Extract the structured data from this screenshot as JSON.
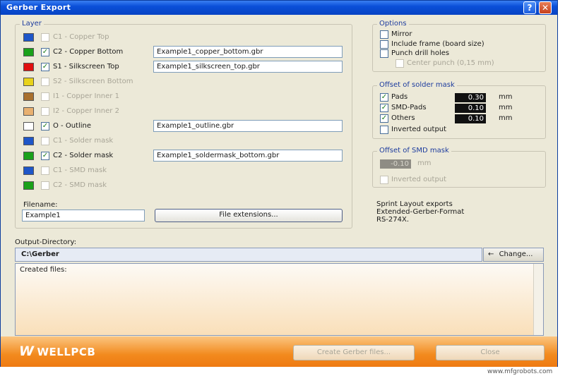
{
  "window": {
    "title": "Gerber Export"
  },
  "titlebar": {
    "help_glyph": "?",
    "close_glyph": "✕"
  },
  "layer_group": {
    "legend": "Layer",
    "layers": [
      {
        "label": "C1 - Copper Top",
        "color": "#1e56c8",
        "checked": false,
        "enabled": false,
        "filename": ""
      },
      {
        "label": "C2 - Copper Bottom",
        "color": "#1aa11a",
        "checked": true,
        "enabled": true,
        "filename": "Example1_copper_bottom.gbr"
      },
      {
        "label": "S1 - Silkscreen Top",
        "color": "#e01010",
        "checked": true,
        "enabled": true,
        "filename": "Example1_silkscreen_top.gbr"
      },
      {
        "label": "S2 - Silkscreen Bottom",
        "color": "#e8d21a",
        "checked": false,
        "enabled": false,
        "filename": ""
      },
      {
        "label": "I1 - Copper Inner 1",
        "color": "#a8702e",
        "checked": false,
        "enabled": false,
        "filename": ""
      },
      {
        "label": "I2 - Copper Inner 2",
        "color": "#e8b070",
        "checked": false,
        "enabled": false,
        "filename": ""
      },
      {
        "label": "O - Outline",
        "color": "#ffffff",
        "checked": true,
        "enabled": true,
        "filename": "Example1_outline.gbr"
      },
      {
        "label": "C1 - Solder mask",
        "color": "#1e56c8",
        "checked": false,
        "enabled": false,
        "filename": ""
      },
      {
        "label": "C2 - Solder mask",
        "color": "#1aa11a",
        "checked": true,
        "enabled": true,
        "filename": "Example1_soldermask_bottom.gbr"
      },
      {
        "label": "C1 - SMD mask",
        "color": "#1e56c8",
        "checked": false,
        "enabled": false,
        "filename": ""
      },
      {
        "label": "C2 - SMD mask",
        "color": "#1aa11a",
        "checked": false,
        "enabled": false,
        "filename": ""
      }
    ],
    "filename_label": "Filename:",
    "filename_value": "Example1",
    "file_ext_button": "File extensions..."
  },
  "options": {
    "legend": "Options",
    "mirror": "Mirror",
    "include_frame": "Include frame (board size)",
    "punch_drill": "Punch drill holes",
    "center_punch": "Center punch (0,15 mm)"
  },
  "solder_offset": {
    "legend": "Offset of solder mask",
    "rows": [
      {
        "label": "Pads",
        "value": "0.30",
        "unit": "mm"
      },
      {
        "label": "SMD-Pads",
        "value": "0.10",
        "unit": "mm"
      },
      {
        "label": "Others",
        "value": "0.10",
        "unit": "mm"
      }
    ],
    "inverted": "Inverted output"
  },
  "smd_offset": {
    "legend": "Offset of SMD mask",
    "value": "-0.10",
    "unit": "mm",
    "inverted": "Inverted output"
  },
  "info_text": [
    "Sprint Layout exports",
    "Extended-Gerber-Format",
    "RS-274X."
  ],
  "output": {
    "label": "Output-Directory:",
    "path": "C:\\Gerber",
    "change_button": "Change...",
    "change_arrow": "←",
    "created_label": "Created files:"
  },
  "footer": {
    "logo": "WELLPCB",
    "create_button": "Create Gerber files...",
    "close_button": "Close"
  },
  "watermark": "www.mfgrobots.com"
}
